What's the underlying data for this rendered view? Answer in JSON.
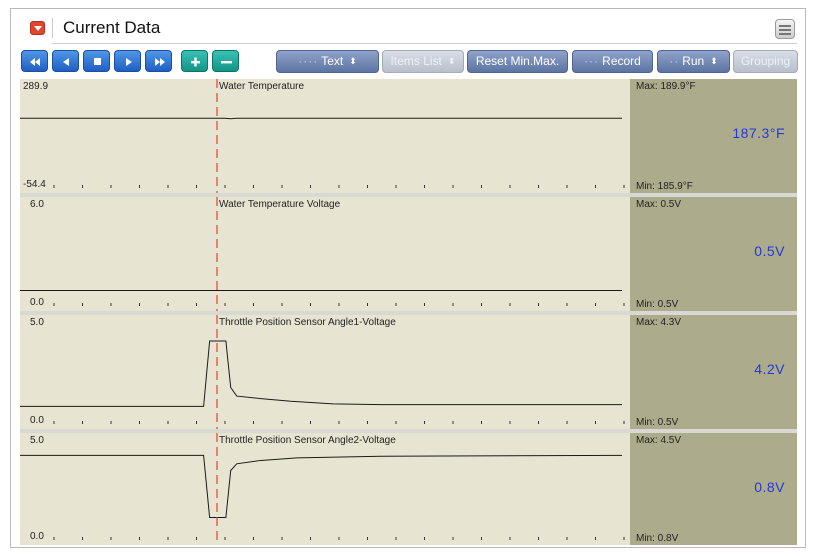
{
  "header": {
    "title": "Current Data"
  },
  "toolbar": {
    "text_label": "Text",
    "items_list_label": "Items List",
    "reset_label": "Reset Min.Max.",
    "record_label": "Record",
    "run_label": "Run",
    "grouping_label": "Grouping"
  },
  "panels": [
    {
      "name": "Water Temperature",
      "y_max": "289.9",
      "y_min": "-54.4",
      "max": "Max: 189.9°F",
      "min": "Min: 185.9°F",
      "current": "187.3°F",
      "y_range": [
        -54.4,
        289.9
      ],
      "trace": [
        [
          0,
          189
        ],
        [
          34,
          189
        ],
        [
          35,
          187
        ],
        [
          36,
          189
        ],
        [
          100,
          189
        ]
      ]
    },
    {
      "name": "Water Temperature Voltage",
      "y_max": "6.0",
      "y_min": "0.0",
      "max": "Max:  0.5V",
      "min": "Min:  0.5V",
      "current": "0.5V",
      "y_range": [
        0,
        6
      ],
      "trace": [
        [
          0,
          0.45
        ],
        [
          100,
          0.45
        ]
      ]
    },
    {
      "name": "Throttle Position Sensor Angle1-Voltage",
      "y_max": "5.0",
      "y_min": "0.0",
      "max": "Max:  4.3V",
      "min": "Min:  0.5V",
      "current": "4.2V",
      "y_range": [
        0,
        5
      ],
      "trace": [
        [
          0,
          0.5
        ],
        [
          30.5,
          0.5
        ],
        [
          31.5,
          4.3
        ],
        [
          34.2,
          4.3
        ],
        [
          35,
          1.6
        ],
        [
          36,
          1.1
        ],
        [
          40,
          0.95
        ],
        [
          45,
          0.8
        ],
        [
          52,
          0.65
        ],
        [
          60,
          0.6
        ],
        [
          100,
          0.6
        ]
      ]
    },
    {
      "name": "Throttle Position Sensor Angle2-Voltage",
      "y_max": "5.0",
      "y_min": "0.0",
      "max": "Max:  4.5V",
      "min": "Min:  0.8V",
      "current": "0.8V",
      "y_range": [
        0,
        5
      ],
      "trace": [
        [
          0,
          4.5
        ],
        [
          30.5,
          4.5
        ],
        [
          31.5,
          0.8
        ],
        [
          34.2,
          0.8
        ],
        [
          35,
          3.6
        ],
        [
          36,
          4.0
        ],
        [
          40,
          4.2
        ],
        [
          46,
          4.35
        ],
        [
          60,
          4.45
        ],
        [
          100,
          4.5
        ]
      ]
    }
  ]
}
